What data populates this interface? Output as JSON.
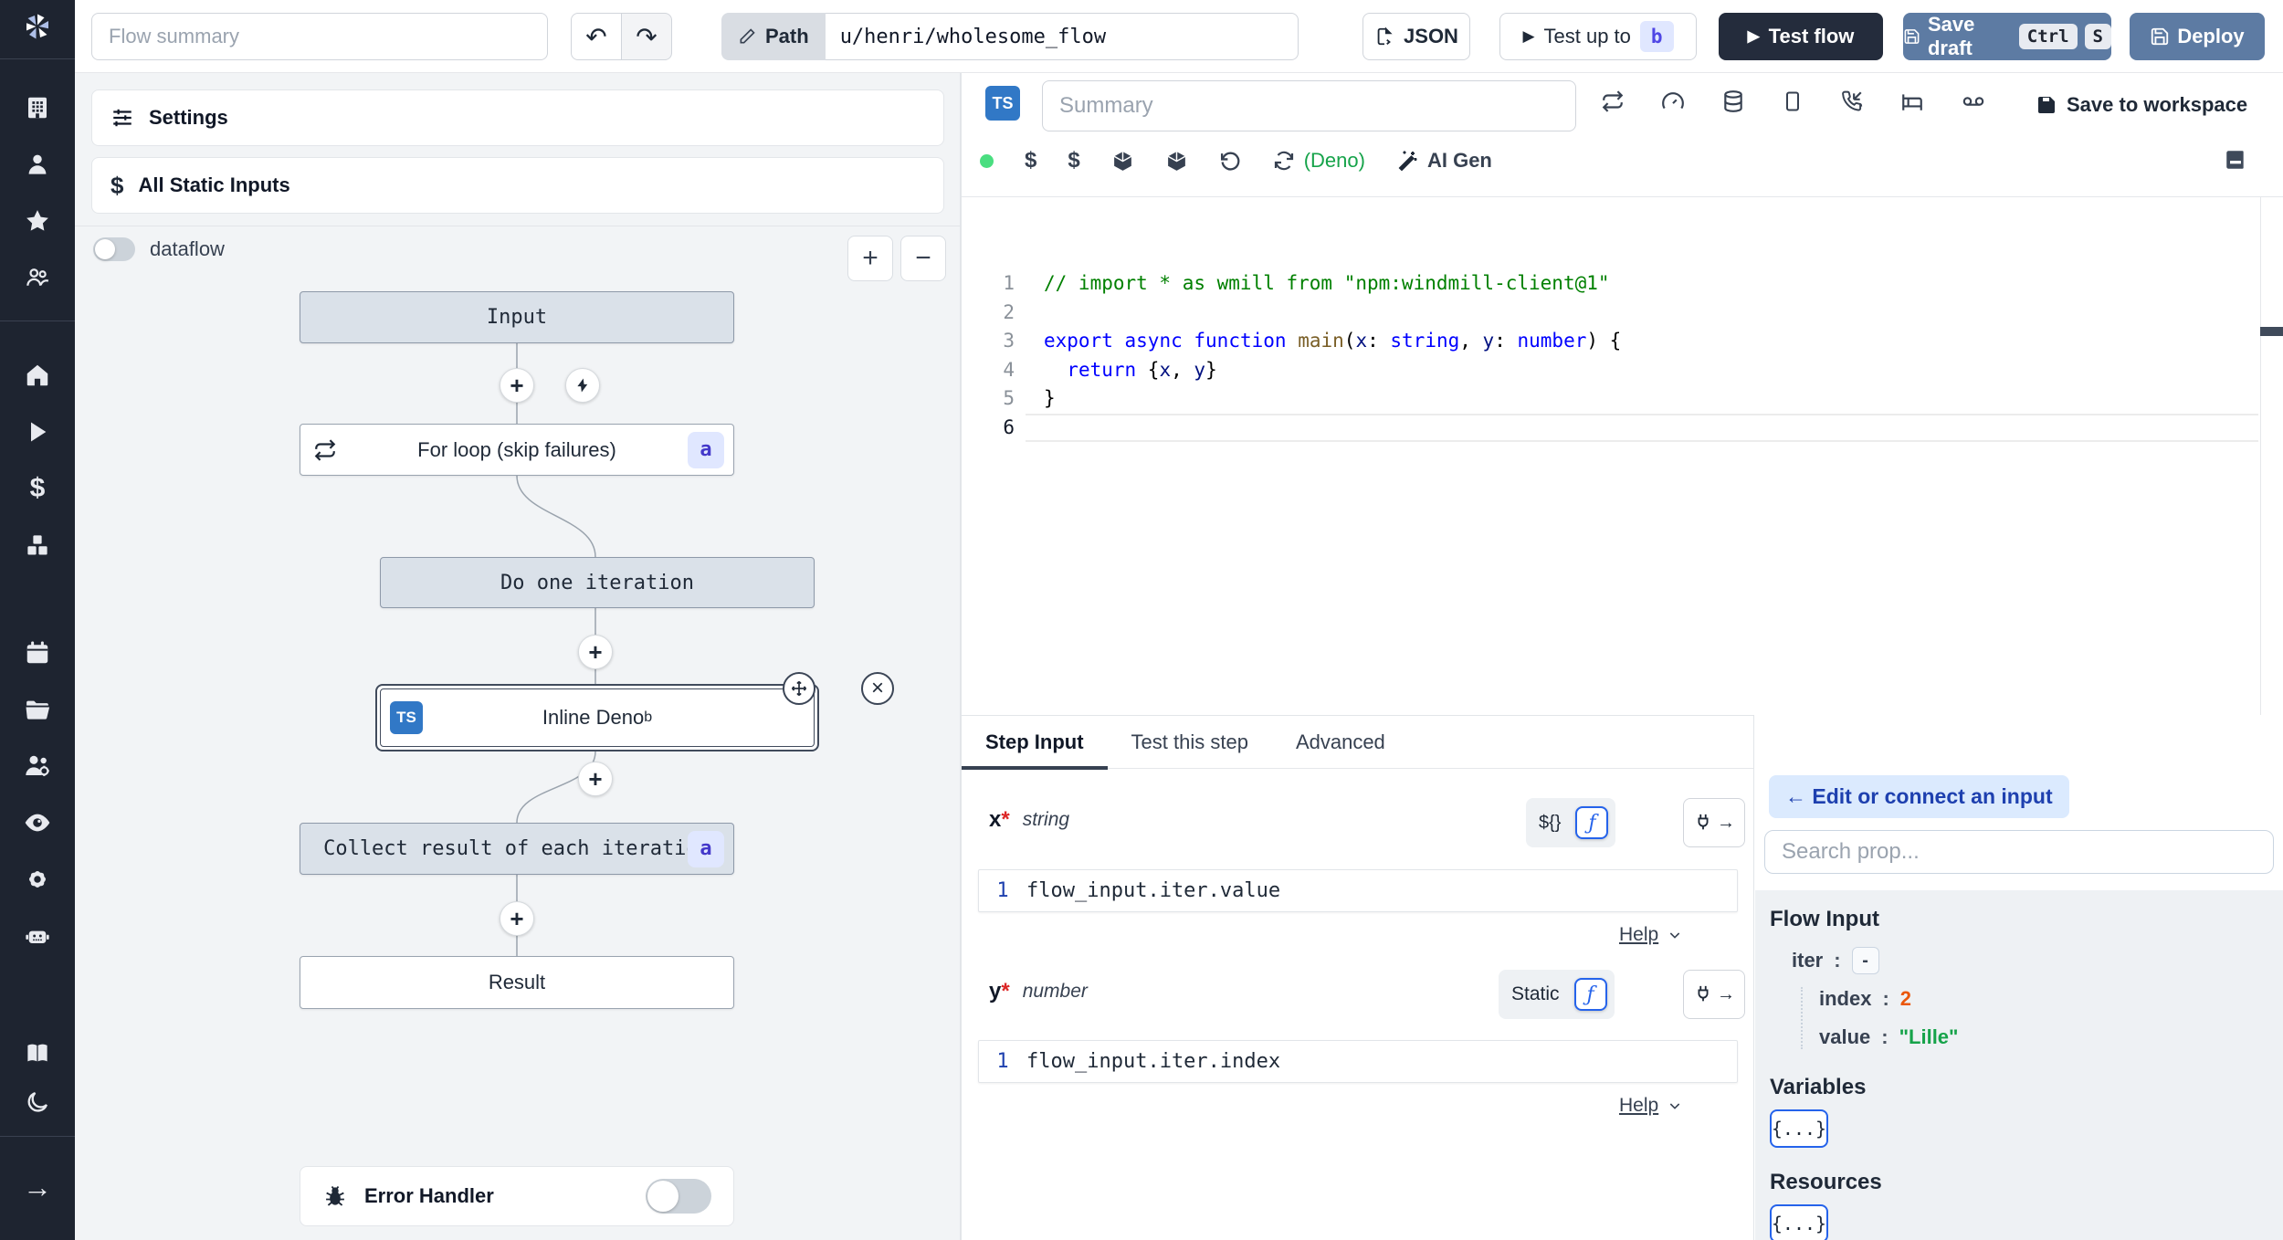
{
  "topbar": {
    "flow_summary_placeholder": "Flow summary",
    "path_label": "Path",
    "path_value": "u/henri/wholesome_flow",
    "json_button": "JSON",
    "test_up_to_label": "Test up to",
    "test_up_to_badge": "b",
    "test_flow_label": "Test flow",
    "save_draft_label": "Save draft",
    "save_draft_kbd_1": "Ctrl",
    "save_draft_kbd_2": "S",
    "deploy_label": "Deploy"
  },
  "icons": {
    "plus": "+",
    "minus": "−",
    "undo": "↶",
    "redo": "↷",
    "play": "▶",
    "close": "×",
    "arrow_right": "→",
    "dollar": "$",
    "sidebar_names": [
      "windmill-logo",
      "building",
      "user",
      "star",
      "users",
      "home",
      "play",
      "dollar",
      "cubes",
      "calendar",
      "folder",
      "user-cog",
      "eye",
      "settings",
      "bot",
      "book",
      "moon",
      "arrow-right"
    ]
  },
  "flow_panel": {
    "settings_label": "Settings",
    "static_inputs_label": "All Static Inputs",
    "dataflow_label": "dataflow",
    "zoom_in": "+",
    "zoom_out": "−",
    "nodes": {
      "input": {
        "label": "Input"
      },
      "forloop": {
        "label": "For loop (skip failures)",
        "badge": "a"
      },
      "doone": {
        "label": "Do one iteration"
      },
      "inline": {
        "label": "Inline Deno",
        "badge": "b",
        "lang": "TS"
      },
      "collect": {
        "label": "Collect result of each iteration",
        "badge": "a"
      },
      "result": {
        "label": "Result"
      }
    },
    "error_handler_label": "Error Handler"
  },
  "editor": {
    "lang_badge": "TS",
    "summary_placeholder": "Summary",
    "deno_label": "(Deno)",
    "ai_gen_label": "AI Gen",
    "save_to_workspace_label": "Save to workspace",
    "code_lines": [
      [
        {
          "t": "// import * as wmill from \"npm:windmill-client@1\"",
          "c": "com"
        }
      ],
      [],
      [
        {
          "t": "export",
          "c": "kw"
        },
        {
          "t": " ",
          "c": "pl"
        },
        {
          "t": "async",
          "c": "kw"
        },
        {
          "t": " ",
          "c": "pl"
        },
        {
          "t": "function",
          "c": "kw"
        },
        {
          "t": " ",
          "c": "pl"
        },
        {
          "t": "main",
          "c": "fn"
        },
        {
          "t": "(",
          "c": "pl"
        },
        {
          "t": "x",
          "c": "param"
        },
        {
          "t": ": ",
          "c": "pl"
        },
        {
          "t": "string",
          "c": "type"
        },
        {
          "t": ", ",
          "c": "pl"
        },
        {
          "t": "y",
          "c": "param"
        },
        {
          "t": ": ",
          "c": "pl"
        },
        {
          "t": "number",
          "c": "type"
        },
        {
          "t": ") {",
          "c": "pl"
        }
      ],
      [
        {
          "t": "  ",
          "c": "pl"
        },
        {
          "t": "return",
          "c": "kw"
        },
        {
          "t": " {",
          "c": "pl"
        },
        {
          "t": "x",
          "c": "param"
        },
        {
          "t": ", ",
          "c": "pl"
        },
        {
          "t": "y",
          "c": "param"
        },
        {
          "t": "}",
          "c": "pl"
        }
      ],
      [
        {
          "t": "}",
          "c": "pl"
        }
      ],
      []
    ]
  },
  "step_panel": {
    "tabs": {
      "0": "Step Input",
      "1": "Test this step",
      "2": "Advanced"
    },
    "fields": {
      "x": {
        "name": "x",
        "required": "*",
        "type": "string",
        "toggle_left": "${}",
        "toggle_right": "ƒ",
        "line_no": "1",
        "value": "flow_input.iter.value",
        "help": "Help"
      },
      "y": {
        "name": "y",
        "required": "*",
        "type": "number",
        "toggle_left": "Static",
        "toggle_right": "ƒ",
        "line_no": "1",
        "value": "flow_input.iter.index",
        "help": "Help"
      }
    }
  },
  "prop_panel": {
    "edit_connect_label": "← Edit or connect an input",
    "search_placeholder": "Search prop...",
    "flow_input_title": "Flow Input",
    "tree": {
      "iter_key": "iter",
      "iter_colon": ":",
      "iter_value": "-",
      "index_key": "index",
      "index_colon": ":",
      "index_value": "2",
      "value_key": "value",
      "value_colon": ":",
      "value_value": "\"Lille\""
    },
    "variables_title": "Variables",
    "variables_chip": "{...}",
    "resources_title": "Resources",
    "resources_chip": "{...}"
  }
}
